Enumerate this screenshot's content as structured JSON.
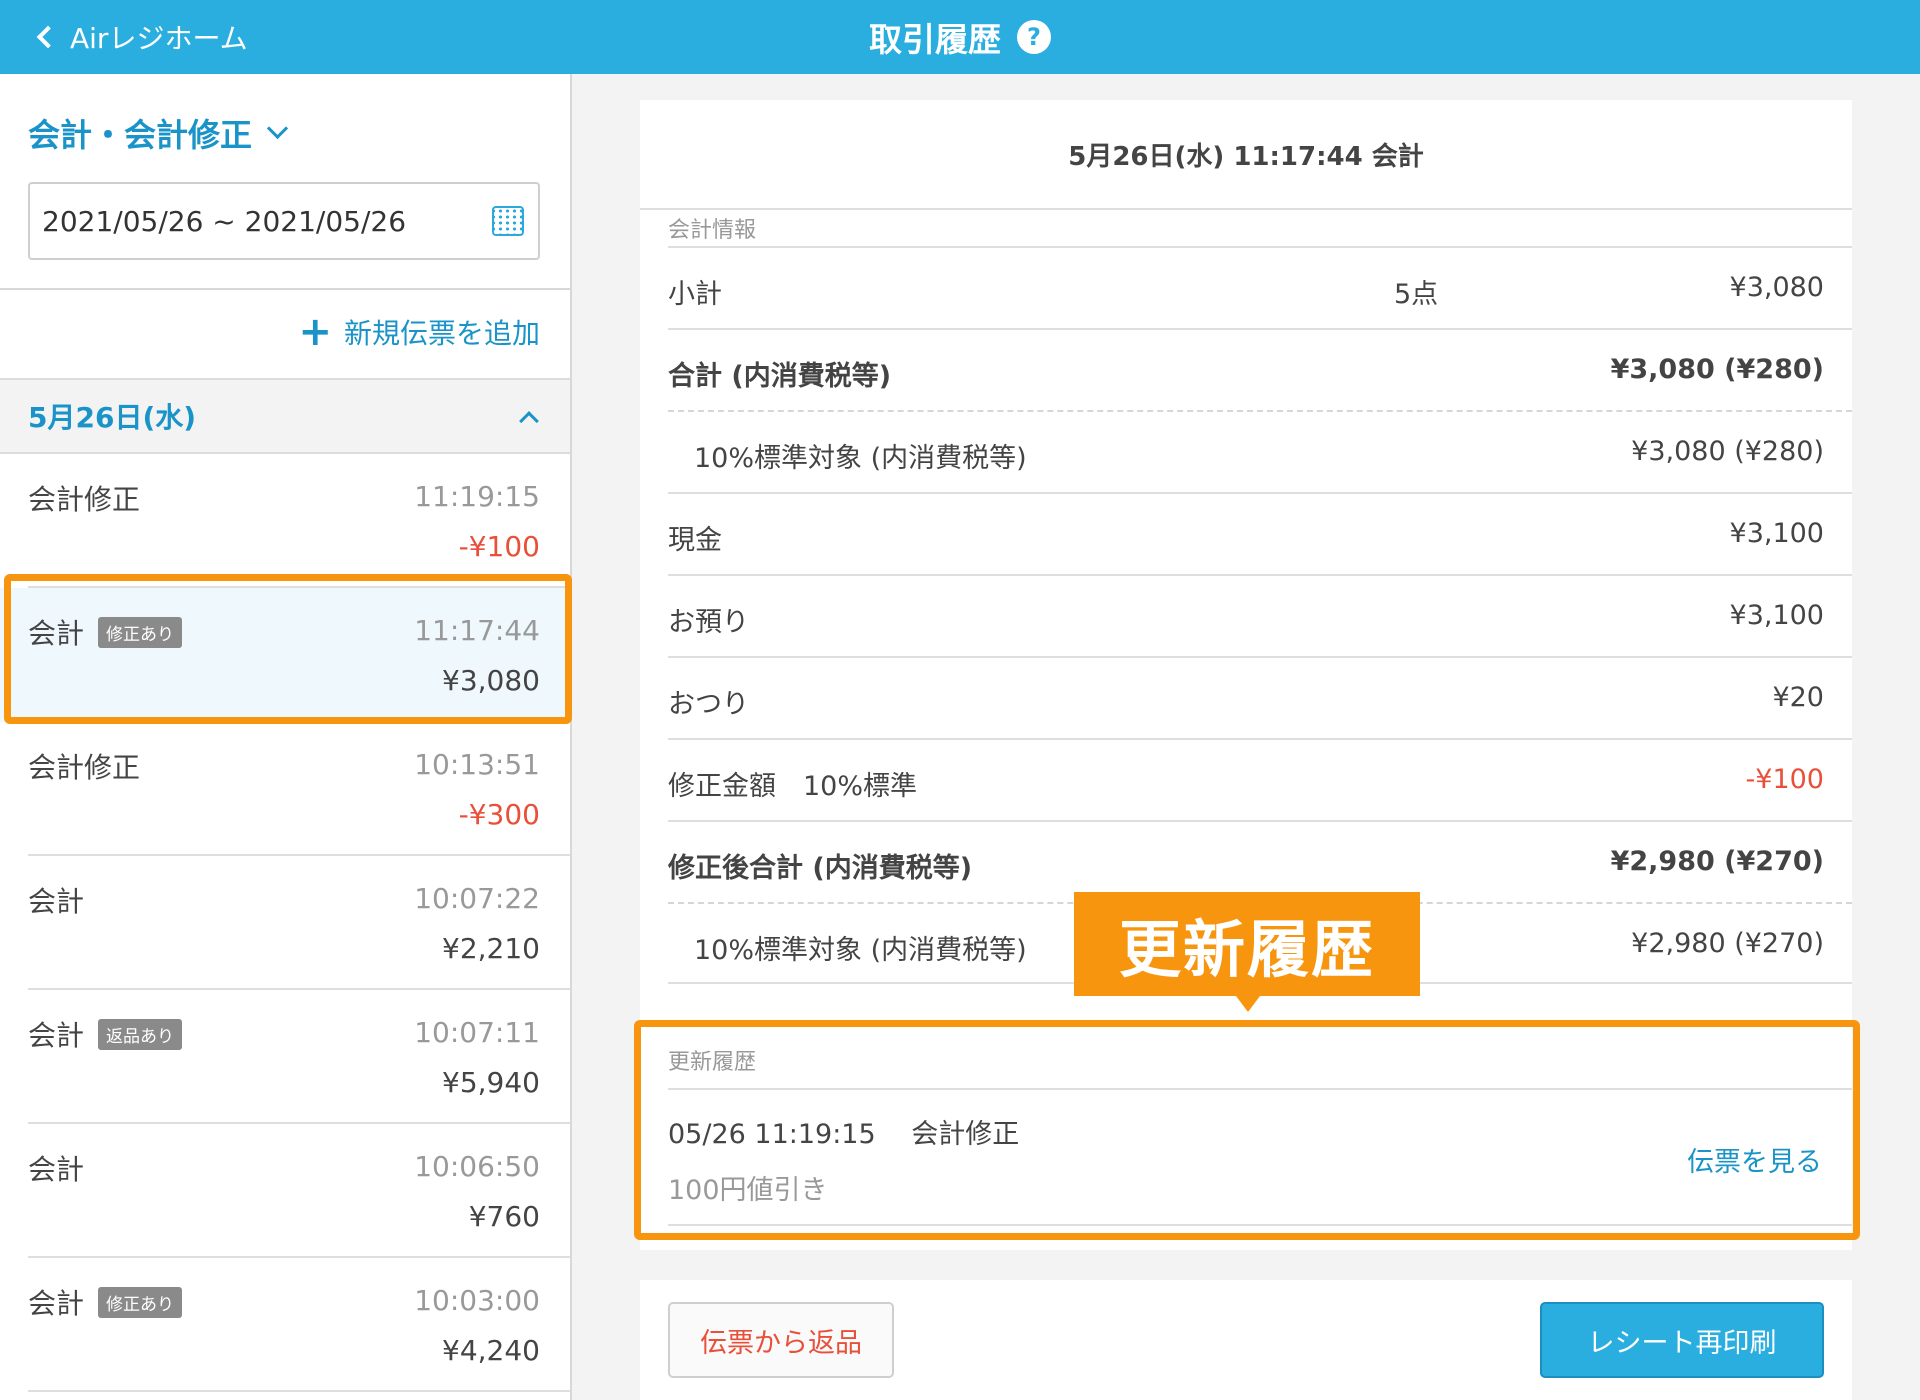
{
  "header": {
    "back_label": "Airレジホーム",
    "title": "取引履歴",
    "help": "?"
  },
  "sidebar": {
    "filter_label": "会計・会計修正",
    "date_range": "2021/05/26 ~ 2021/05/26",
    "add_new_label": "新規伝票を追加",
    "day_header": "5月26日(水)",
    "transactions": [
      {
        "name": "会計修正",
        "badge": "",
        "time": "11:19:15",
        "amount": "-¥100"
      },
      {
        "name": "会計",
        "badge": "修正あり",
        "time": "11:17:44",
        "amount": "¥3,080"
      },
      {
        "name": "会計修正",
        "badge": "",
        "time": "10:13:51",
        "amount": "-¥300"
      },
      {
        "name": "会計",
        "badge": "",
        "time": "10:07:22",
        "amount": "¥2,210"
      },
      {
        "name": "会計",
        "badge": "返品あり",
        "time": "10:07:11",
        "amount": "¥5,940"
      },
      {
        "name": "会計",
        "badge": "",
        "time": "10:06:50",
        "amount": "¥760"
      },
      {
        "name": "会計",
        "badge": "修正あり",
        "time": "10:03:00",
        "amount": "¥4,240"
      }
    ]
  },
  "detail": {
    "title": "5月26日(水) 11:17:44 会計",
    "section_label": "会計情報",
    "rows": [
      {
        "label": "小計",
        "qty": "5点",
        "value": "¥3,080"
      },
      {
        "label": "合計 (内消費税等)",
        "value": "¥3,080 (¥280)"
      },
      {
        "label": "10%標準対象 (内消費税等)",
        "value": "¥3,080 (¥280)"
      },
      {
        "label": "現金",
        "value": "¥3,100"
      },
      {
        "label": "お預り",
        "value": "¥3,100"
      },
      {
        "label": "おつり",
        "value": "¥20"
      },
      {
        "label": "修正金額　10%標準",
        "value": "-¥100"
      },
      {
        "label": "修正後合計 (内消費税等)",
        "value": "¥2,980 (¥270)"
      },
      {
        "label": "10%標準対象 (内消費税等)",
        "value": "¥2,980 (¥270)"
      }
    ],
    "update_section_label": "更新履歴",
    "update_entry": "05/26 11:19:15　 会計修正",
    "update_note": "100円値引き",
    "view_slip_label": "伝票を見る",
    "callout": "更新履歴"
  },
  "footer": {
    "return_label": "伝票から返品",
    "reprint_label": "レシート再印刷"
  },
  "colors": {
    "brand": "#2aaee0",
    "link": "#1a94c8",
    "negative": "#e8503a",
    "highlight": "#f7950e"
  }
}
